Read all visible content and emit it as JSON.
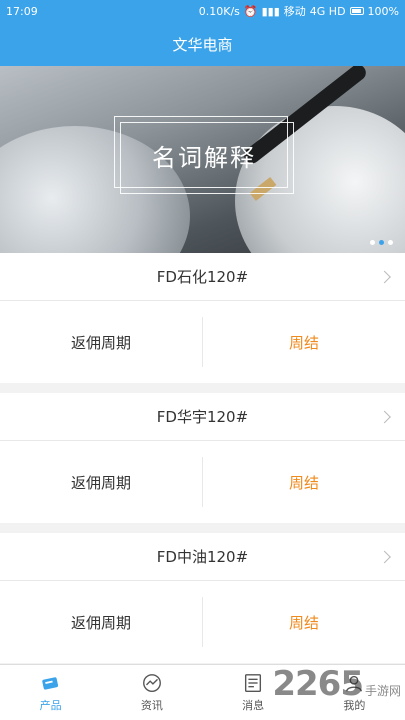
{
  "status_bar": {
    "time": "17:09",
    "net_speed": "0.10K/s",
    "carrier": "移动",
    "network": "4G HD",
    "battery": "100%"
  },
  "header": {
    "title": "文华电商"
  },
  "banner": {
    "title": "名词解释",
    "page_count": 3,
    "active_page": 2
  },
  "products": [
    {
      "name": "FD石化120#",
      "label": "返佣周期",
      "value": "周结"
    },
    {
      "name": "FD华宇120#",
      "label": "返佣周期",
      "value": "周结"
    },
    {
      "name": "FD中油120#",
      "label": "返佣周期",
      "value": "周结"
    }
  ],
  "tabs": [
    {
      "label": "产品",
      "icon": "product-icon",
      "active": true
    },
    {
      "label": "资讯",
      "icon": "news-icon",
      "active": false
    },
    {
      "label": "消息",
      "icon": "message-icon",
      "active": false
    },
    {
      "label": "我的",
      "icon": "profile-icon",
      "active": false
    }
  ],
  "watermark": {
    "text": "2265",
    "suffix": "手游网"
  },
  "colors": {
    "primary": "#3ba3ea",
    "accent": "#f08a1c"
  }
}
